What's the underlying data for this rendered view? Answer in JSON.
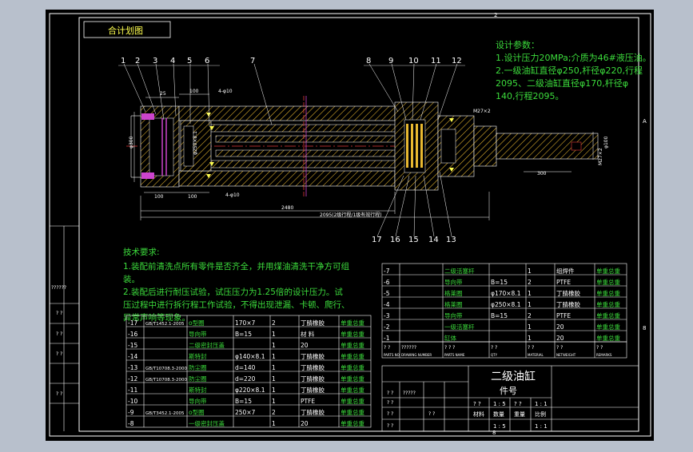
{
  "drawing": {
    "view_label": "合计划图",
    "border_marks": [
      "2",
      "8",
      "A",
      "8"
    ],
    "part_numbers_top": [
      "1",
      "2",
      "3",
      "4",
      "5",
      "6",
      "7",
      "8",
      "9",
      "10",
      "11",
      "12"
    ],
    "part_numbers_bottom": [
      "17",
      "16",
      "15",
      "14",
      "13"
    ],
    "dims": {
      "d25": "25",
      "d100a": "100",
      "d4m10": "4-φ10",
      "d100b": "100",
      "d100c": "100",
      "d4m10b": "4-φ10",
      "d2480": "2480",
      "d2095": "2095(2级行程/1级有效行程)",
      "d300": "300",
      "dM27": "M27×2",
      "dM272": "M27×2",
      "dphi100": "φ100",
      "dphi300": "φ300",
      "dphi250": "φ250×8.1"
    },
    "section_labels": [
      "A"
    ]
  },
  "design": {
    "title": "设计参数：",
    "lines": [
      "1.设计压力20MPa;介质为46#液压油。",
      "2.一级油缸直径φ250,杆径φ220,行程",
      "2095、二级油缸直径φ170,杆径φ",
      "140,行程2095。"
    ]
  },
  "tech": {
    "title": "技术要求:",
    "lines": [
      "1.装配前清洗点所有零件是否齐全，并用煤油清洗干净方可组",
      "装。",
      "2.装配后进行耐压试验，试压压力为1.25倍的设计压力。试",
      "压过程中进行拆行程工作试验，不得出现泄漏、卡顿、爬行、",
      "异常声响等现象。"
    ]
  },
  "left_strip": {
    "labels": [
      "??????",
      "? ?",
      "? ?",
      "? ?",
      "? ?"
    ]
  },
  "bom_left": {
    "rows": [
      [
        "-17",
        "GB/T1452.1-2005",
        "o型圈",
        "170×7",
        "2",
        "丁腈橡胶",
        "单重总重"
      ],
      [
        "-16",
        "",
        "导向带",
        "B=15",
        "1",
        "材 料",
        "单重总重"
      ],
      [
        "-15",
        "",
        "二级密封压盖",
        "",
        "1",
        "20",
        "单重总重"
      ],
      [
        "-14",
        "",
        "斯特封",
        "φ140×8.1",
        "1",
        "丁腈橡胶",
        "单重总重"
      ],
      [
        "-13",
        "GB/T10708.3-2000",
        "防尘圈",
        "d=140",
        "1",
        "丁腈橡胶",
        "单重总重"
      ],
      [
        "-12",
        "GB/T10708.3-2000",
        "防尘圈",
        "d=220",
        "1",
        "丁腈橡胶",
        "单重总重"
      ],
      [
        "-11",
        "",
        "斯特封",
        "φ220×8.1",
        "1",
        "丁腈橡胶",
        "单重总重"
      ],
      [
        "-10",
        "",
        "导向带",
        "B=15",
        "1",
        "PTFE",
        "单重总重"
      ],
      [
        "-9",
        "GB/T3452.1-2005",
        "o型圈",
        "250×7",
        "2",
        "丁腈橡胶",
        "单重总重"
      ],
      [
        "-8",
        "",
        "一级密封压盖",
        "",
        "1",
        "20",
        "单重总重"
      ]
    ]
  },
  "bom_right": {
    "rows": [
      [
        "-7",
        "",
        "二级活塞杆",
        "",
        "1",
        "组焊件",
        "单重总重"
      ],
      [
        "-6",
        "",
        "导向带",
        "B=15",
        "2",
        "PTFE",
        "单重总重"
      ],
      [
        "-5",
        "",
        "格莱圈",
        "φ170×8.1",
        "1",
        "丁腈橡胶",
        "单重总重"
      ],
      [
        "-4",
        "",
        "格莱圈",
        "φ250×8.1",
        "1",
        "丁腈橡胶",
        "单重总重"
      ],
      [
        "-3",
        "",
        "导向带",
        "B=15",
        "2",
        "PTFE",
        "单重总重"
      ],
      [
        "-2",
        "",
        "一级活塞杆",
        "",
        "1",
        "20",
        "单重总重"
      ],
      [
        "-1",
        "",
        "缸体",
        "",
        "1",
        "20",
        "单重总重"
      ]
    ],
    "header": [
      "? ?",
      "??????",
      "? ? ?",
      "? ?",
      "? ?",
      "? ?",
      "? ?"
    ],
    "header2": [
      "PARTS NO",
      "DRAWING NUMBER",
      "PARTS NAME",
      "QTY",
      "MATERIAL",
      "NETWEIGHT",
      "REMARKS"
    ]
  },
  "title_block": {
    "name": "二级油缸",
    "subtitle": "件号",
    "cells": [
      "? ?",
      "? ?",
      "? ?",
      "? ?",
      "? ?",
      "? ? ?"
    ],
    "bottom": [
      "材料",
      "数量",
      "重量",
      "比例"
    ],
    "bottom_vals": [
      "? ?",
      "1 : 5",
      "? ?",
      "1 : 1"
    ],
    "marks": [
      "?????",
      "? ?",
      "? ?",
      "? ?",
      "? ?",
      "? ?"
    ]
  },
  "colors": {
    "background": "#000000",
    "frame": "#ffffff",
    "hatch": "#e8b830",
    "centerline": "#e23a3a",
    "text_green": "#3cdc3c",
    "text_yellow": "#ffff50",
    "seal": "#cc44cc",
    "page_bg": "#b8c0cc"
  }
}
